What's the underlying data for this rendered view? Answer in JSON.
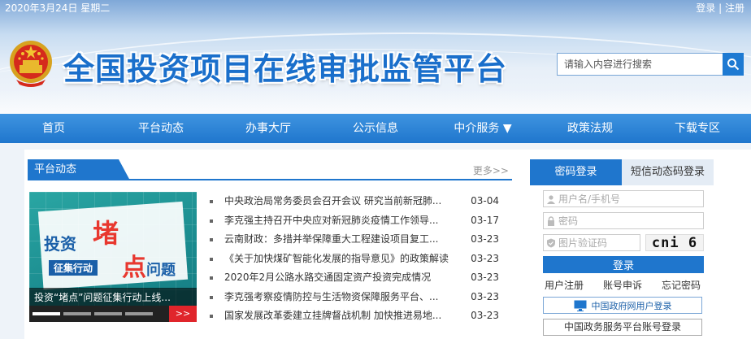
{
  "topbar": {
    "date": "2020年3月24日 星期二",
    "login_link": "登录",
    "separator": " | ",
    "register_link": "注册"
  },
  "header": {
    "site_title": "全国投资项目在线审批监管平台",
    "search_placeholder": "请输入内容进行搜索"
  },
  "nav": {
    "items": [
      {
        "label": "首页"
      },
      {
        "label": "平台动态"
      },
      {
        "label": "办事大厅"
      },
      {
        "label": "公示信息"
      },
      {
        "label": "中介服务 ▼"
      },
      {
        "label": "政策法规"
      },
      {
        "label": "下载专区"
      }
    ]
  },
  "news": {
    "section_title": "平台动态",
    "more_label": "更多>>",
    "banner": {
      "word_1": "投资",
      "word_2": "堵",
      "word_3": "征集行动",
      "word_4": "点",
      "word_5": "问题",
      "caption": "投资“堵点”问题征集行动上线...",
      "next_label": ">>"
    },
    "items": [
      {
        "title": "中央政治局常务委员会召开会议 研究当前新冠肺...",
        "date": "03-04"
      },
      {
        "title": "李克强主持召开中央应对新冠肺炎疫情工作领导...",
        "date": "03-17"
      },
      {
        "title": "云南财政：多措并举保障重大工程建设项目复工...",
        "date": "03-23"
      },
      {
        "title": "《关于加快煤矿智能化发展的指导意见》的政策解读",
        "date": "03-23"
      },
      {
        "title": "2020年2月公路水路交通固定资产投资完成情况",
        "date": "03-23"
      },
      {
        "title": "李克强考察疫情防控与生活物资保障服务平台、...",
        "date": "03-23"
      },
      {
        "title": "国家发展改革委建立挂牌督战机制 加快推进易地...",
        "date": "03-23"
      }
    ]
  },
  "login": {
    "tab_password": "密码登录",
    "tab_sms": "短信动态码登录",
    "username_placeholder": "用户名/手机号",
    "password_placeholder": "密码",
    "captcha_placeholder": "图片验证码",
    "captcha_text": "cni 6",
    "submit_label": "登录",
    "register_label": "用户注册",
    "appeal_label": "账号申诉",
    "forgot_label": "忘记密码",
    "gov_user_login": "中国政府网用户登录",
    "gov_service_login": "中国政务服务平台账号登录"
  },
  "colors": {
    "primary": "#1f76cd",
    "title_blue": "#1a6fcb",
    "banner_teal": "#2aa6a3",
    "accent_red": "#e0252b"
  }
}
